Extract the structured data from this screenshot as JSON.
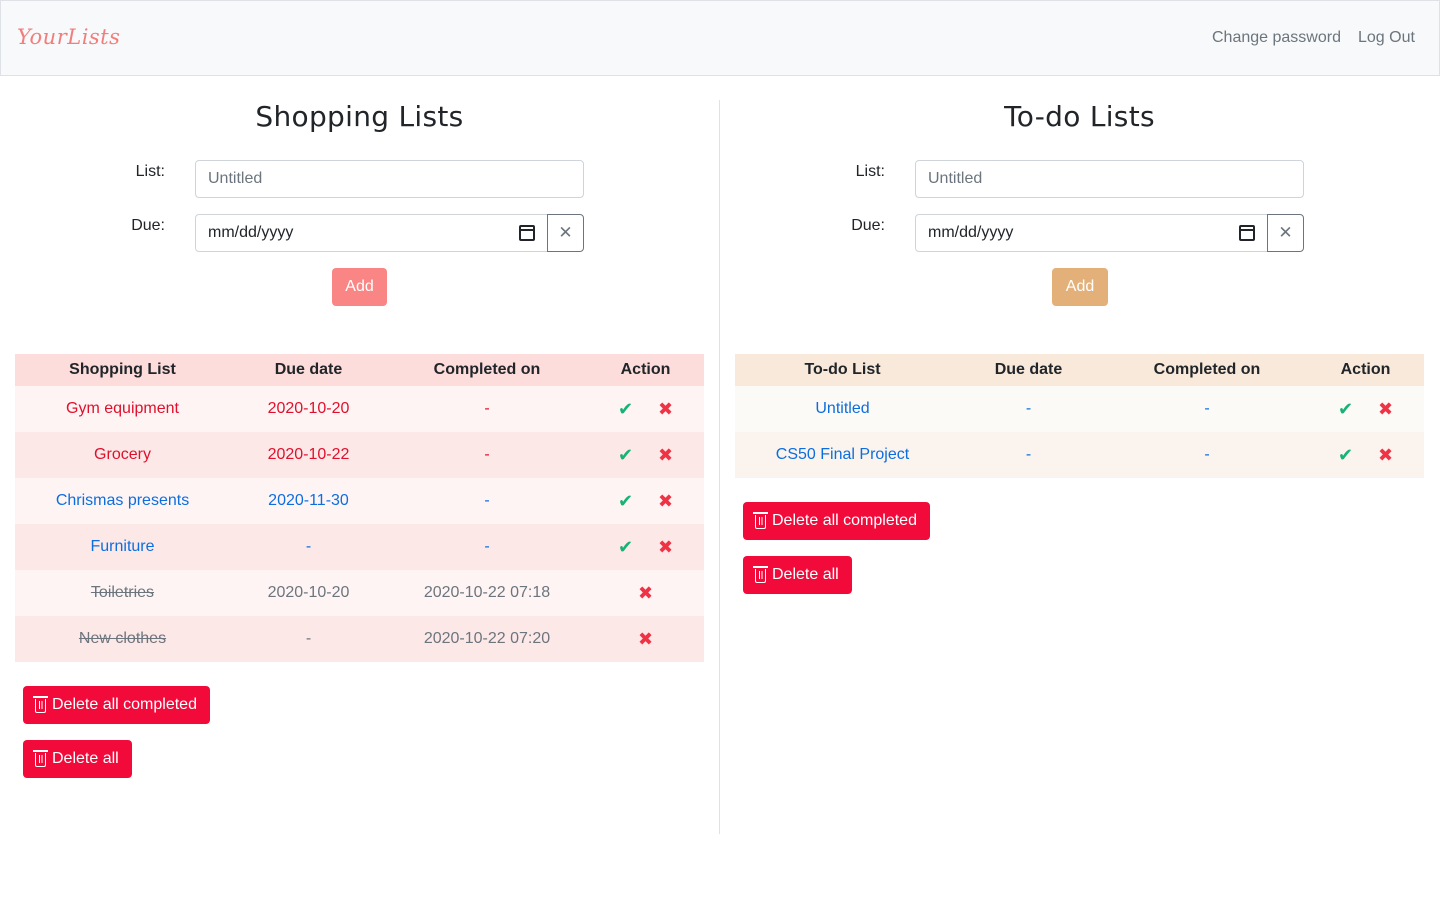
{
  "app": {
    "brand": "YourLists"
  },
  "nav": {
    "change_password": "Change password",
    "logout": "Log Out"
  },
  "colors": {
    "brand": "#f27d7d",
    "danger": "#f20a3a",
    "link": "#0c6ede",
    "overdue": "#e0102c",
    "complete": "#18b374"
  },
  "shopping": {
    "title": "Shopping Lists",
    "form": {
      "list_label": "List:",
      "list_placeholder": "Untitled",
      "due_label": "Due:",
      "due_placeholder": "mm/dd/yyyy",
      "add_label": "Add"
    },
    "columns": [
      "Shopping List",
      "Due date",
      "Completed on",
      "Action"
    ],
    "rows": [
      {
        "name": "Gym equipment",
        "due": "2020-10-20",
        "completed": "-",
        "status": "overdue"
      },
      {
        "name": "Grocery",
        "due": "2020-10-22",
        "completed": "-",
        "status": "overdue"
      },
      {
        "name": "Chrismas presents",
        "due": "2020-11-30",
        "completed": "-",
        "status": "open"
      },
      {
        "name": "Furniture",
        "due": "-",
        "completed": "-",
        "status": "open"
      },
      {
        "name": "Toiletries",
        "due": "2020-10-20",
        "completed": "2020-10-22 07:18",
        "status": "done"
      },
      {
        "name": "New clothes",
        "due": "-",
        "completed": "2020-10-22 07:20",
        "status": "done"
      }
    ],
    "delete_completed_label": "Delete all completed",
    "delete_all_label": "Delete all"
  },
  "todo": {
    "title": "To-do Lists",
    "form": {
      "list_label": "List:",
      "list_placeholder": "Untitled",
      "due_label": "Due:",
      "due_placeholder": "mm/dd/yyyy",
      "add_label": "Add"
    },
    "columns": [
      "To-do List",
      "Due date",
      "Completed on",
      "Action"
    ],
    "rows": [
      {
        "name": "Untitled",
        "due": "-",
        "completed": "-",
        "status": "open"
      },
      {
        "name": "CS50 Final Project",
        "due": "-",
        "completed": "-",
        "status": "open"
      }
    ],
    "delete_completed_label": "Delete all completed",
    "delete_all_label": "Delete all"
  },
  "icons": {
    "complete": "check-icon",
    "remove": "x-icon",
    "clear": "x-icon",
    "calendar": "calendar-icon",
    "delete": "trash-icon"
  }
}
